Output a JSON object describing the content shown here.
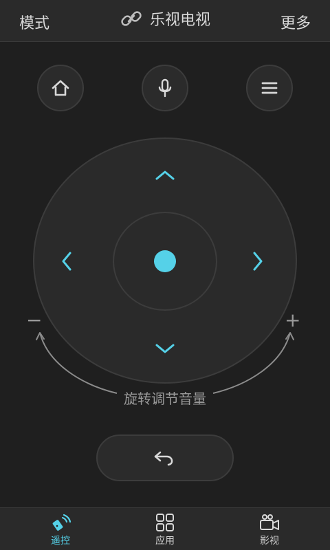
{
  "header": {
    "left_label": "模式",
    "title": "乐视电视",
    "right_label": "更多"
  },
  "controls": {
    "volume_label": "旋转调节音量",
    "minus_symbol": "−",
    "plus_symbol": "+"
  },
  "bottom_nav": {
    "tabs": [
      {
        "label": "遥控"
      },
      {
        "label": "应用"
      },
      {
        "label": "影视"
      }
    ]
  },
  "colors": {
    "accent": "#55d1e8"
  },
  "icons": {
    "link": "link-icon",
    "home": "home-icon",
    "mic": "microphone-icon",
    "menu": "menu-icon",
    "up": "chevron-up-icon",
    "down": "chevron-down-icon",
    "left": "chevron-left-icon",
    "right": "chevron-right-icon",
    "back": "back-arrow-icon",
    "remote": "remote-icon",
    "apps": "apps-grid-icon",
    "video": "video-camera-icon"
  }
}
